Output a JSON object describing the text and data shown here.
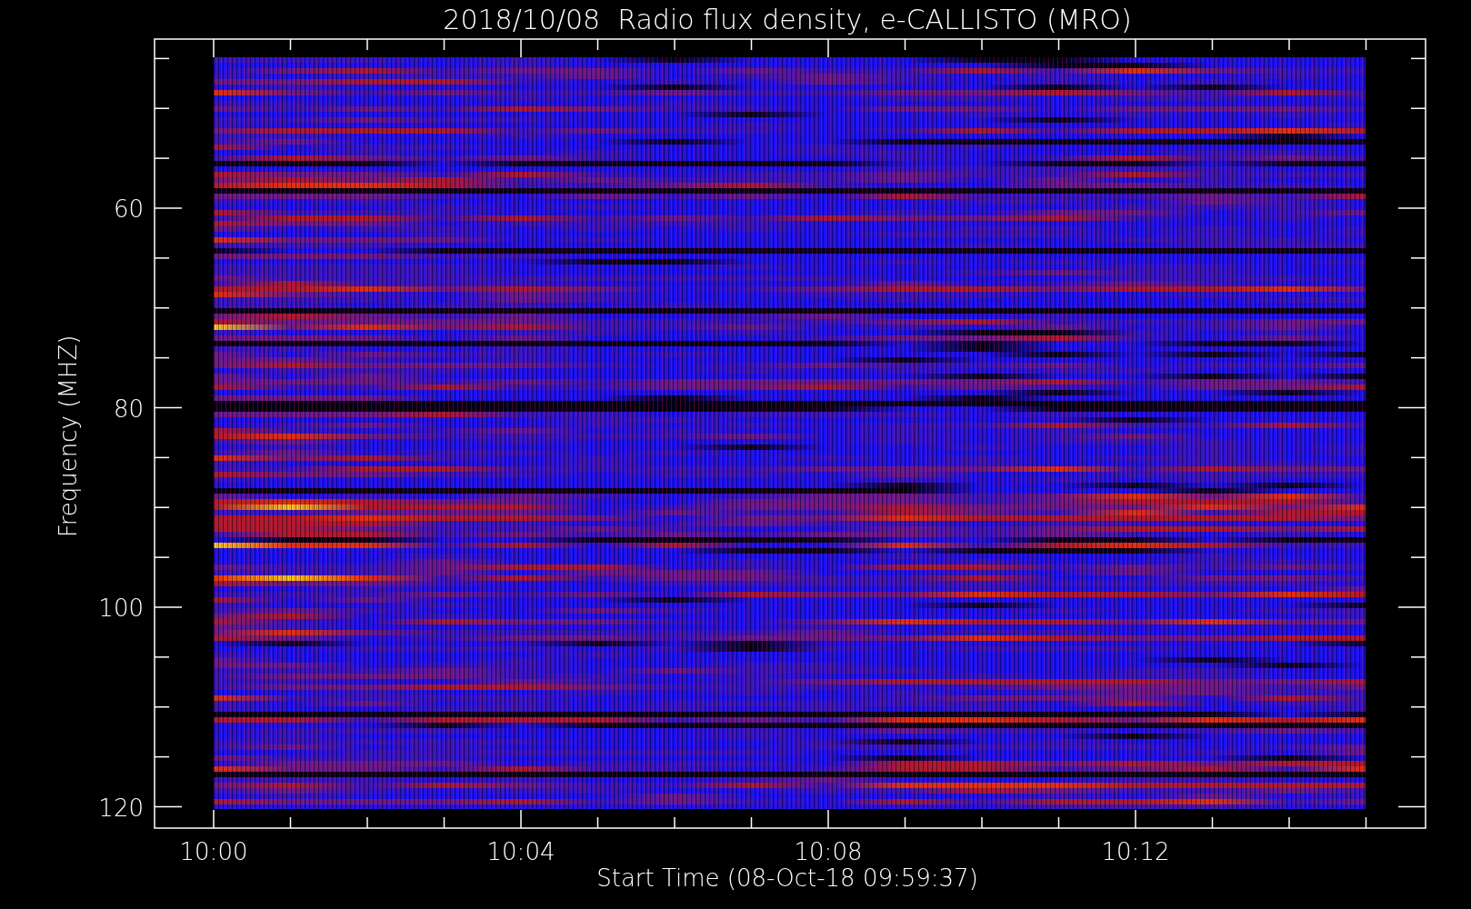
{
  "plot": {
    "title": "2018/10/08  Radio flux density, e-CALLISTO (MRO)",
    "x_axis": {
      "label": "Start Time (08-Oct-18 09:59:37)",
      "ticks": [
        "10:00",
        "10:04",
        "10:08",
        "10:12"
      ]
    },
    "y_axis": {
      "label": "Frequency (MHZ)",
      "ticks": [
        "60",
        "80",
        "100",
        "120"
      ]
    }
  }
}
